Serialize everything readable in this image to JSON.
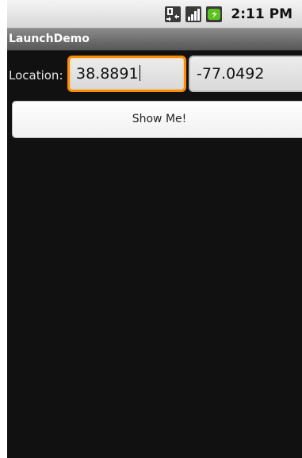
{
  "status_bar": {
    "time": "2:11 PM",
    "icons": [
      "data-transfer-icon",
      "signal-icon",
      "battery-charging-icon"
    ]
  },
  "app": {
    "title": "LaunchDemo"
  },
  "form": {
    "location_label": "Location:",
    "latitude_value": "38.8891",
    "longitude_value": "-77.0492",
    "submit_label": "Show Me!"
  },
  "colors": {
    "focus_border": "#ff8c00",
    "background": "#111111",
    "title_bar": "#6e6e6e"
  }
}
